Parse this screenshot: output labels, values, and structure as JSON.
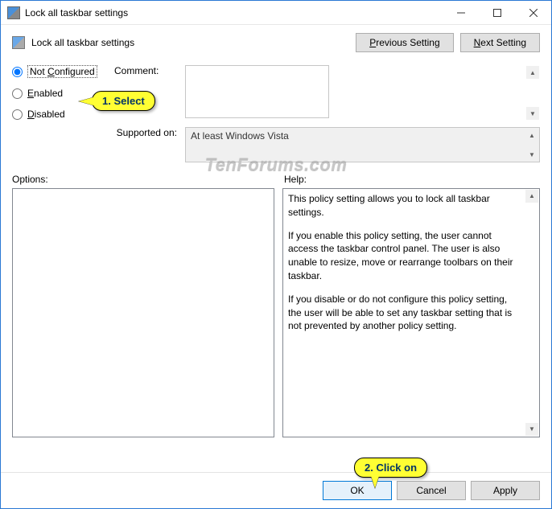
{
  "titlebar": {
    "title": "Lock all taskbar settings"
  },
  "header": {
    "title": "Lock all taskbar settings",
    "prev": "Previous Setting",
    "next": "Next Setting"
  },
  "radios": {
    "not_configured": "Not Configured",
    "enabled": "Enabled",
    "disabled": "Disabled"
  },
  "labels": {
    "comment": "Comment:",
    "supported": "Supported on:",
    "options": "Options:",
    "help": "Help:"
  },
  "supported_text": "At least Windows Vista",
  "help": {
    "p1": "This policy setting allows you to lock all taskbar settings.",
    "p2": "If you enable this policy setting, the user cannot access the taskbar control panel. The user is also unable to resize, move or rearrange toolbars on their taskbar.",
    "p3": "If you disable or do not configure this policy setting, the user will be able to set any taskbar setting that is not prevented by another policy setting."
  },
  "footer": {
    "ok": "OK",
    "cancel": "Cancel",
    "apply": "Apply"
  },
  "callouts": {
    "c1": "1. Select",
    "c2": "2. Click on"
  },
  "watermark": "TenForums.com"
}
